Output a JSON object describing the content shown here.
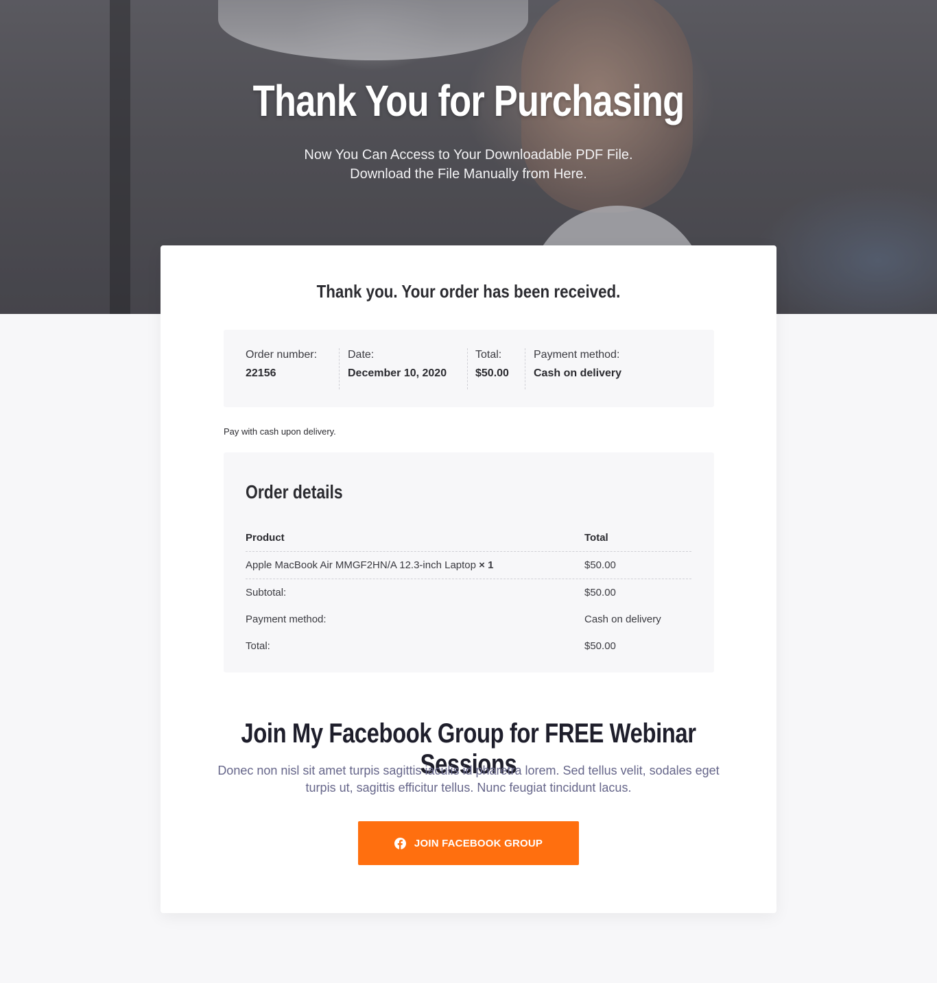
{
  "hero": {
    "title": "Thank You for Purchasing",
    "subtitle_line1": "Now You Can Access to Your Downloadable PDF File.",
    "subtitle_line2": "Download the File Manually from Here."
  },
  "order": {
    "heading": "Thank you. Your order has been received.",
    "overview": [
      {
        "label": "Order number:",
        "value": "22156"
      },
      {
        "label": "Date:",
        "value": "December 10, 2020"
      },
      {
        "label": "Total:",
        "value": "$50.00"
      },
      {
        "label": "Payment method:",
        "value": "Cash on delivery"
      }
    ],
    "payment_note": "Pay with cash upon delivery."
  },
  "details": {
    "title": "Order details",
    "header": {
      "product": "Product",
      "total": "Total"
    },
    "item": {
      "name": "Apple MacBook Air MMGF2HN/A 12.3-inch Laptop",
      "qty": "× 1",
      "total": "$50.00"
    },
    "subtotal": {
      "label": "Subtotal:",
      "value": "$50.00"
    },
    "payment": {
      "label": "Payment method:",
      "value": "Cash on delivery"
    },
    "total": {
      "label": "Total:",
      "value": "$50.00"
    }
  },
  "facebook": {
    "title": "Join My Facebook Group for FREE Webinar Sessions",
    "description": "Donec non nisl sit amet turpis sagittis iaculis id pharetra lorem. Sed tellus velit, sodales eget turpis ut, sagittis efficitur tellus. Nunc feugiat tincidunt lacus.",
    "button_label": "JOIN FACEBOOK GROUP",
    "button_icon": "facebook-icon"
  },
  "colors": {
    "accent": "#ff6f0f",
    "heading": "#1e1e2b",
    "muted_text": "#66668a",
    "panel_bg": "#f7f7f9"
  }
}
